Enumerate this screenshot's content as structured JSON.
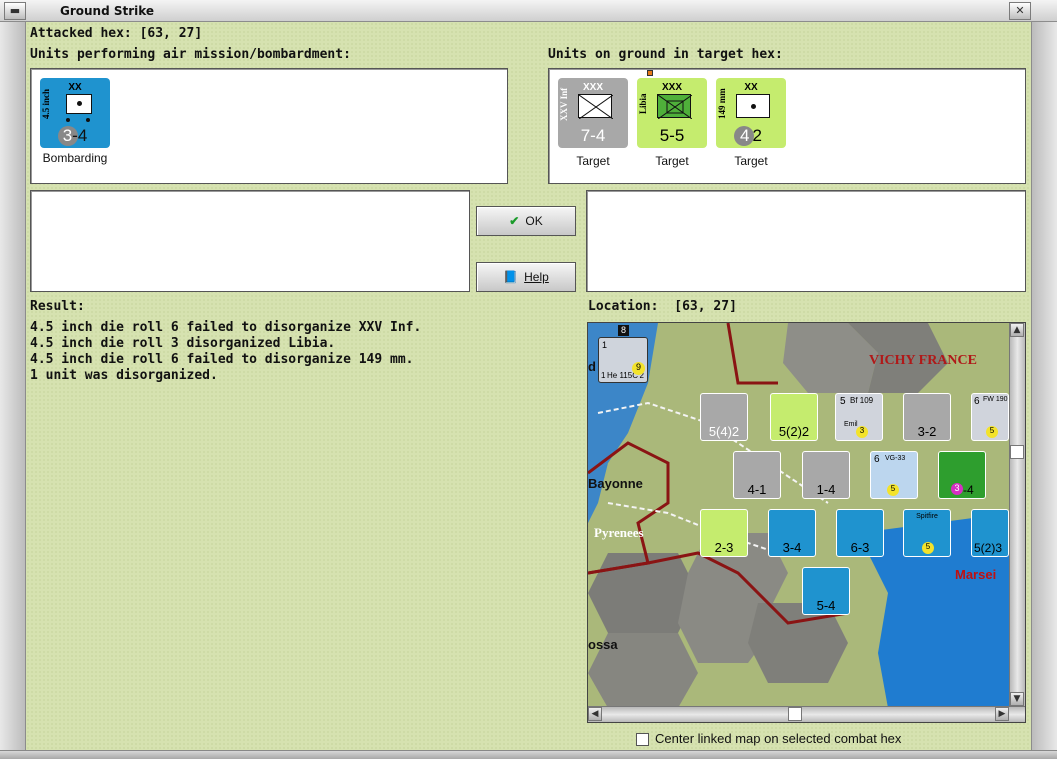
{
  "window": {
    "title": "Ground Strike"
  },
  "attacked": {
    "label": "Attacked hex:",
    "value": "[63, 27]"
  },
  "attackers": {
    "header": "Units performing air mission/bombardment:",
    "units": [
      {
        "name": "4.5 inch",
        "size": "XX",
        "str_a": "3",
        "str_b": "-4",
        "caption": "Bombarding",
        "color": "#1f93cf"
      }
    ]
  },
  "defenders": {
    "header": "Units on ground in target hex:",
    "units": [
      {
        "name": "XXV Inf",
        "size": "XXX",
        "strength": "7-4",
        "caption": "Target",
        "color": "#a8a8a8"
      },
      {
        "name": "Libia",
        "size": "XXX",
        "strength": "5-5",
        "caption": "Target",
        "color": "#c5ec6e"
      },
      {
        "name": "149 mm",
        "size": "XX",
        "str_a": "4",
        "str_b": "2",
        "caption": "Target",
        "color": "#c5ec6e"
      }
    ]
  },
  "buttons": {
    "ok": "OK",
    "help": "Help"
  },
  "result": {
    "label": "Result:",
    "lines": [
      "4.5 inch die roll 6 failed to disorganize XXV Inf.",
      "4.5 inch die roll 3 disorganized Libia.",
      "4.5 inch die roll 6 failed to disorganize 149 mm.",
      "1 unit was disorganized."
    ]
  },
  "location": {
    "label": "Location:",
    "value": "[63, 27]"
  },
  "map": {
    "places": [
      "VICHY FRANCE",
      "Bayonne",
      "Pyrenees",
      "Marsei",
      "ossa",
      "d"
    ],
    "counters": [
      {
        "label": "He 115C",
        "top": "1",
        "bottom_l": "1",
        "bottom_r": "2",
        "badge": "9",
        "stack": "8"
      },
      {
        "label": "",
        "strength": "5(4)2"
      },
      {
        "label": "",
        "strength": "5(2)2"
      },
      {
        "label": "Bf 109",
        "strength": "5",
        "sub": "Emil",
        "badge": "3",
        "stack": "3"
      },
      {
        "label": "",
        "strength": "3-2",
        "stack": "3"
      },
      {
        "label": "FW 190",
        "strength": "6",
        "badge": "5",
        "stack": "3"
      },
      {
        "label": "",
        "strength": "4-1"
      },
      {
        "label": "",
        "strength": "1-4"
      },
      {
        "label": "VG-33",
        "strength": "6",
        "badge": "5"
      },
      {
        "label": "",
        "strength": "-4",
        "badge": "3",
        "stack": "4"
      },
      {
        "label": "",
        "strength": "2-3"
      },
      {
        "label": "",
        "strength": "3-4",
        "stack": "4"
      },
      {
        "label": "",
        "strength": "6-3",
        "stack": "2"
      },
      {
        "label": "Spitfire",
        "strength": "",
        "badge": "5"
      },
      {
        "label": "",
        "strength": "5(2)3"
      },
      {
        "label": "",
        "strength": "5-4"
      }
    ]
  },
  "footer": {
    "checkbox_label": "Center linked map on selected combat hex"
  },
  "colors": {
    "panel_bg": "#d6e2b0",
    "blue_unit": "#1f93cf",
    "green_unit": "#c5ec6e",
    "grey_unit": "#a8a8a8"
  }
}
